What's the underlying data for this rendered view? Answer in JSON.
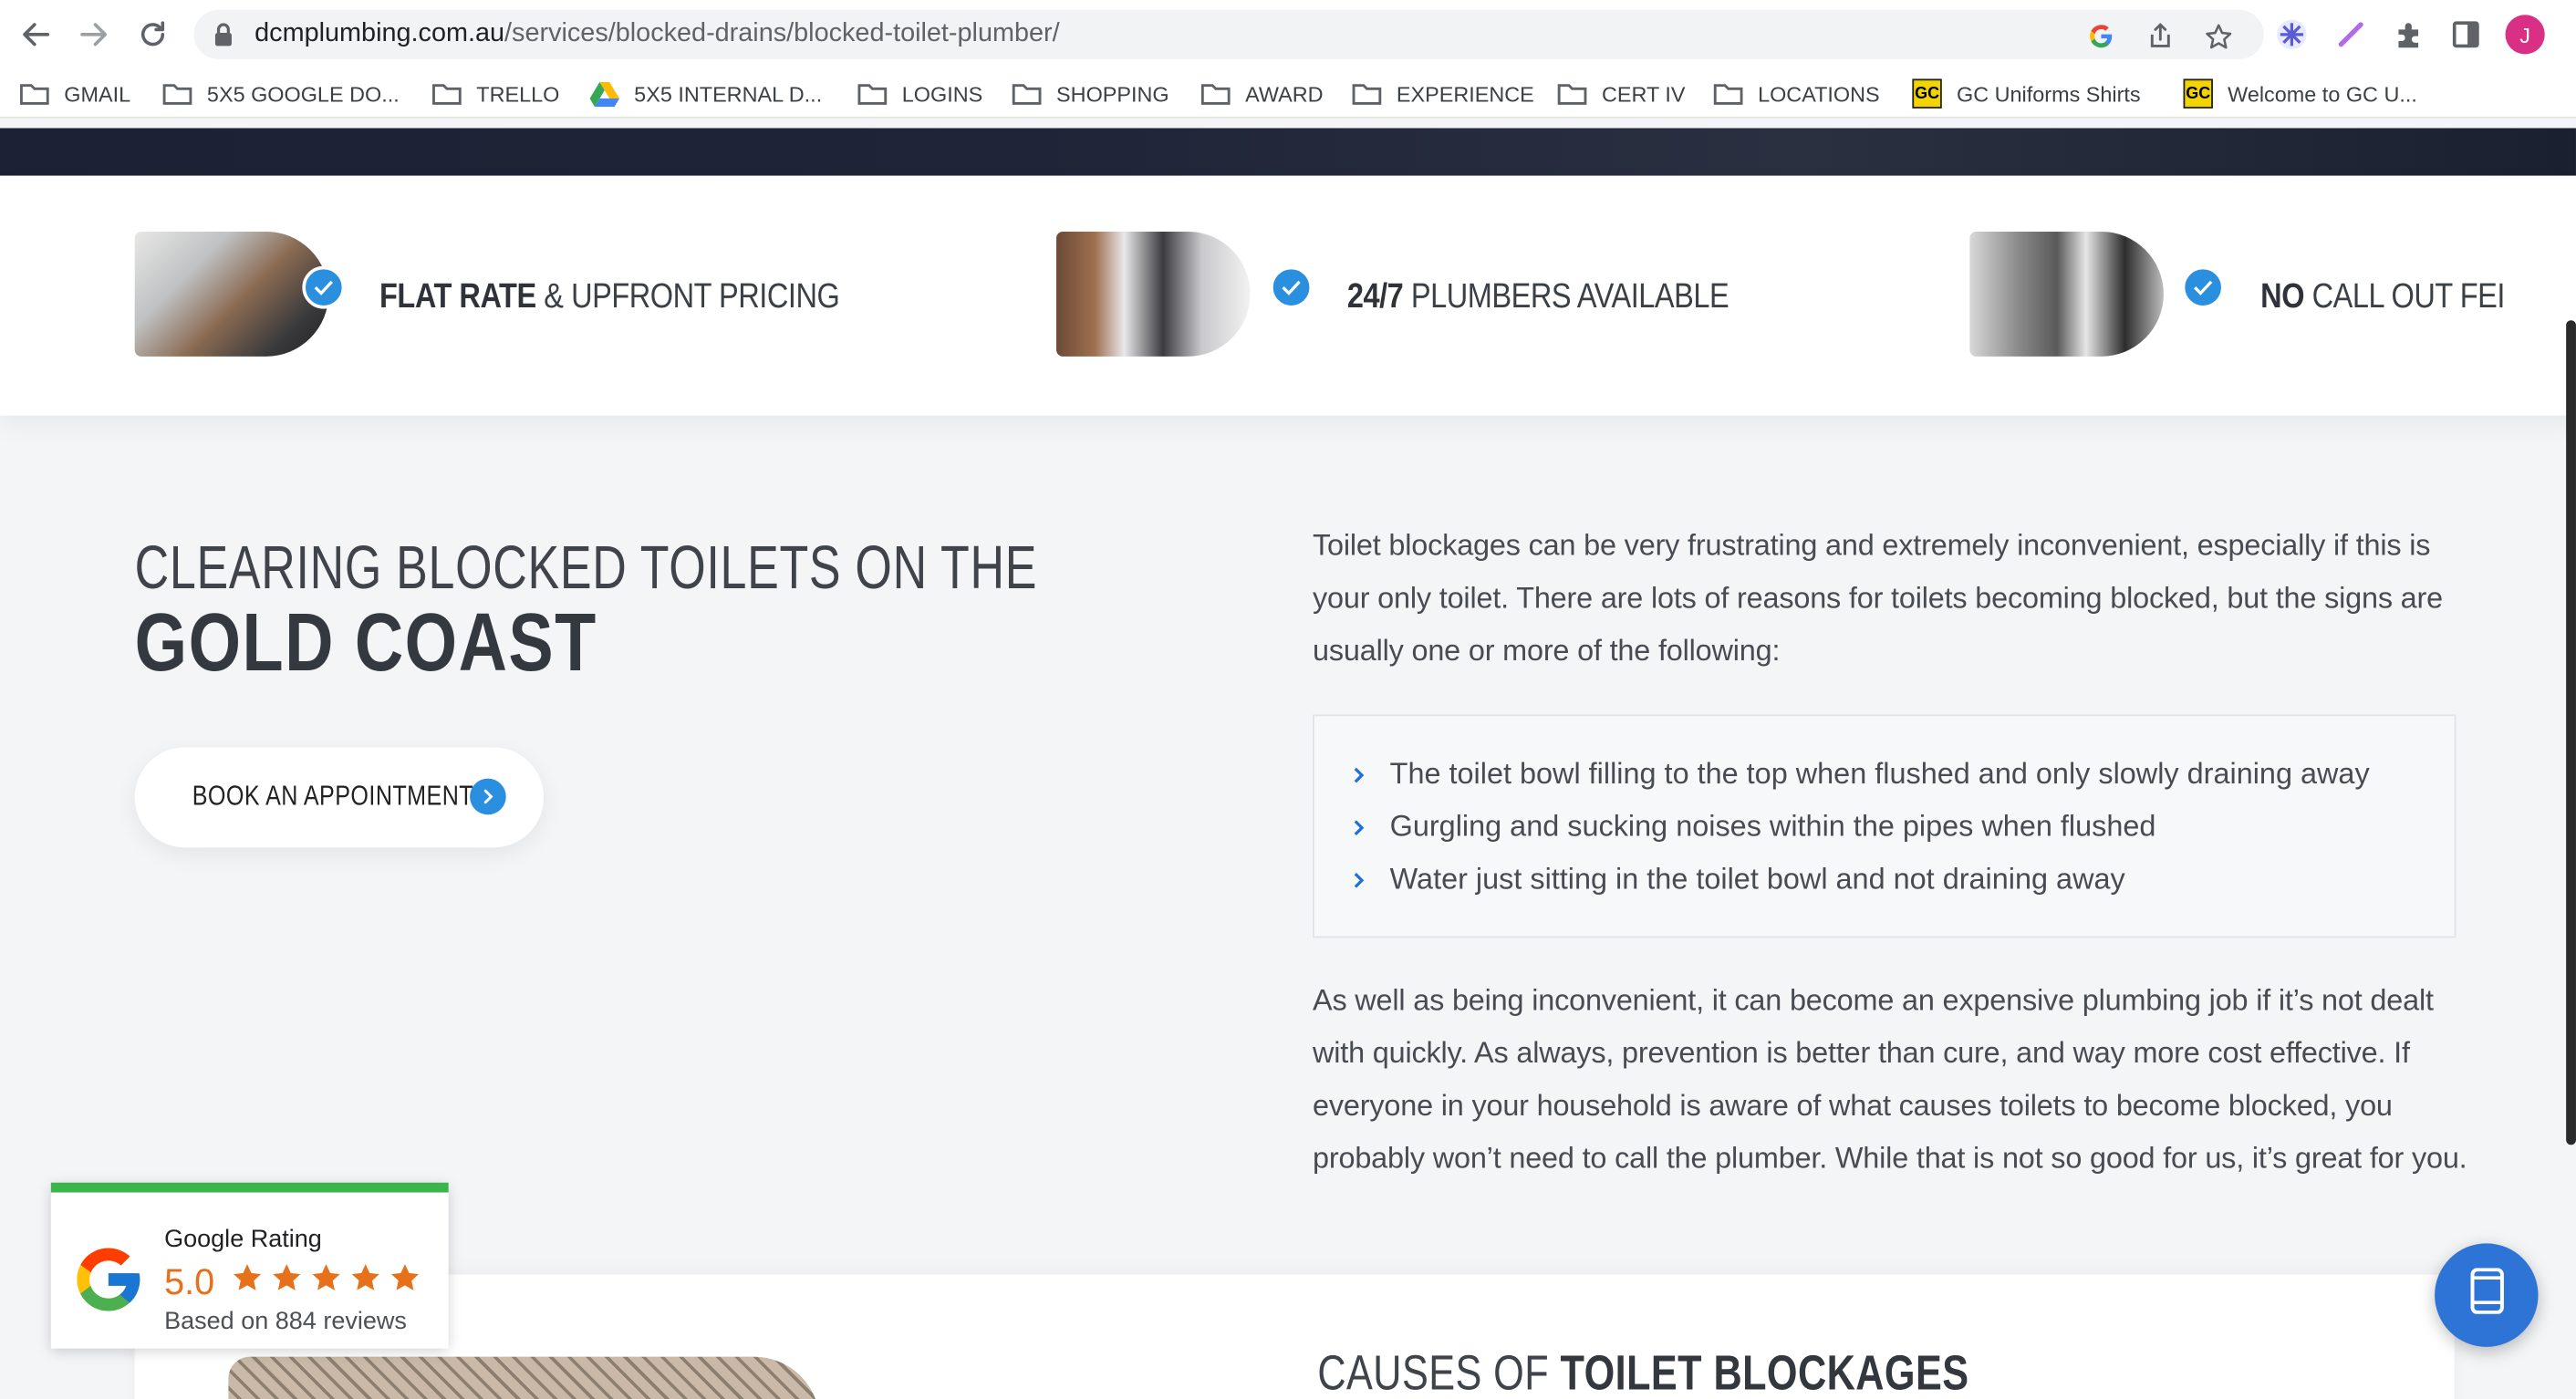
{
  "browser": {
    "url_host": "dcmplumbing.com.au",
    "url_path": "/services/blocked-drains/blocked-toilet-plumber/",
    "avatar_initial": "J"
  },
  "bookmarks": [
    {
      "label": "GMAIL",
      "icon": "folder-icon"
    },
    {
      "label": "5X5 GOOGLE DO...",
      "icon": "folder-icon"
    },
    {
      "label": "TRELLO",
      "icon": "folder-icon"
    },
    {
      "label": "5X5 INTERNAL D...",
      "icon": "google-drive-icon"
    },
    {
      "label": "LOGINS",
      "icon": "folder-icon"
    },
    {
      "label": "SHOPPING",
      "icon": "folder-icon"
    },
    {
      "label": "AWARD",
      "icon": "folder-icon"
    },
    {
      "label": "EXPERIENCE",
      "icon": "folder-icon"
    },
    {
      "label": "CERT IV",
      "icon": "folder-icon"
    },
    {
      "label": "LOCATIONS",
      "icon": "folder-icon"
    },
    {
      "label": "GC Uniforms Shirts",
      "icon": "gc-favicon"
    },
    {
      "label": "Welcome to GC U...",
      "icon": "gc-favicon"
    }
  ],
  "features": [
    {
      "bold": "FLAT RATE",
      "rest": " & UPFRONT PRICING"
    },
    {
      "bold": "24/7",
      "rest": " PLUMBERS AVAILABLE"
    },
    {
      "bold": "NO",
      "rest": " CALL OUT FEI"
    }
  ],
  "heading": {
    "line1": "CLEARING BLOCKED TOILETS ON THE",
    "line2": "GOLD COAST"
  },
  "book_button": "BOOK AN APPOINTMENT",
  "intro": "Toilet blockages can be very frustrating and extremely inconvenient, especially if this is your only toilet. There are lots of reasons for toilets becoming blocked, but the signs are usually one or more of the following:",
  "bullets": [
    "The toilet bowl filling to the top when flushed and only slowly draining away",
    "Gurgling and sucking noises within the pipes when flushed",
    "Water just sitting in the toilet bowl and not draining away"
  ],
  "outro": "As well as being inconvenient, it can become an expensive plumbing job if it’s not dealt with quickly. As always, prevention is better than cure, and way more cost effective. If everyone in your household is aware of what causes toilets to become blocked, you probably won’t need to call the plumber. While that is not so good for us, it’s great for you.",
  "rating": {
    "title": "Google Rating",
    "score": "5.0",
    "stars": 5,
    "based": "Based on 884 reviews"
  },
  "causes": {
    "light": "CAUSES OF ",
    "bold": "TOILET BLOCKAGES"
  },
  "colors": {
    "accent": "#2b8fe0",
    "rating_star": "#e7711b",
    "rating_bar": "#3bb54a"
  }
}
